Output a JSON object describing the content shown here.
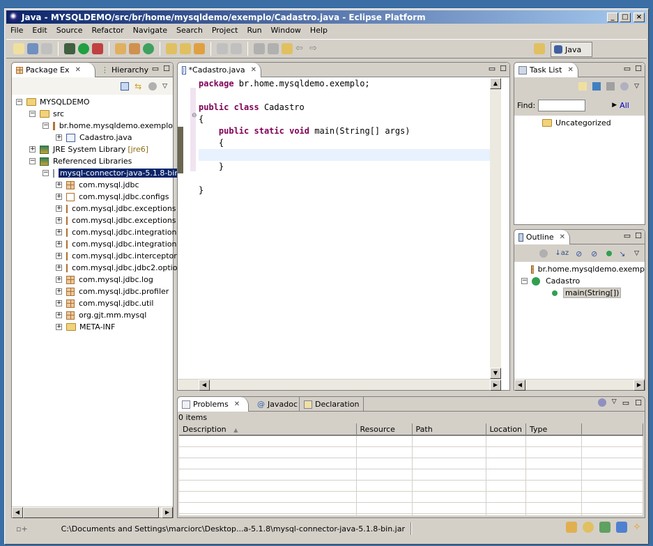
{
  "window": {
    "title": "Java - MYSQLDEMO/src/br/home/mysqldemo/exemplo/Cadastro.java - Eclipse Platform",
    "minimize": "_",
    "maximize": "□",
    "close": "×"
  },
  "menu": [
    "File",
    "Edit",
    "Source",
    "Refactor",
    "Navigate",
    "Search",
    "Project",
    "Run",
    "Window",
    "Help"
  ],
  "perspective": {
    "label": "Java"
  },
  "package_explorer": {
    "tab": "Package Ex",
    "tab2": "Hierarchy",
    "tree": [
      {
        "label": "MYSQLDEMO",
        "level": 0,
        "toggle": "−",
        "icon": "project-icon"
      },
      {
        "label": "src",
        "level": 1,
        "toggle": "−",
        "icon": "source-folder-icon"
      },
      {
        "label": "br.home.mysqldemo.exemplo",
        "level": 2,
        "toggle": "−",
        "icon": "package-icon"
      },
      {
        "label": "Cadastro.java",
        "level": 3,
        "toggle": "+",
        "icon": "java-file-icon"
      },
      {
        "label": "JRE System Library",
        "suffix": "[jre6]",
        "level": 1,
        "toggle": "+",
        "icon": "library-icon"
      },
      {
        "label": "Referenced Libraries",
        "level": 1,
        "toggle": "−",
        "icon": "library-icon"
      },
      {
        "label": "mysql-connector-java-5.1.8-bin",
        "level": 2,
        "toggle": "−",
        "icon": "jar-icon",
        "selected": true
      },
      {
        "label": "com.mysql.jdbc",
        "level": 3,
        "toggle": "+",
        "icon": "package-icon"
      },
      {
        "label": "com.mysql.jdbc.configs",
        "level": 3,
        "toggle": "+",
        "icon": "empty-package-icon"
      },
      {
        "label": "com.mysql.jdbc.exceptions",
        "level": 3,
        "toggle": "+",
        "icon": "package-icon"
      },
      {
        "label": "com.mysql.jdbc.exceptions",
        "level": 3,
        "toggle": "+",
        "icon": "package-icon"
      },
      {
        "label": "com.mysql.jdbc.integration",
        "level": 3,
        "toggle": "+",
        "icon": "package-icon"
      },
      {
        "label": "com.mysql.jdbc.integration",
        "level": 3,
        "toggle": "+",
        "icon": "package-icon"
      },
      {
        "label": "com.mysql.jdbc.interceptor",
        "level": 3,
        "toggle": "+",
        "icon": "package-icon"
      },
      {
        "label": "com.mysql.jdbc.jdbc2.optio",
        "level": 3,
        "toggle": "+",
        "icon": "package-icon"
      },
      {
        "label": "com.mysql.jdbc.log",
        "level": 3,
        "toggle": "+",
        "icon": "package-icon"
      },
      {
        "label": "com.mysql.jdbc.profiler",
        "level": 3,
        "toggle": "+",
        "icon": "package-icon"
      },
      {
        "label": "com.mysql.jdbc.util",
        "level": 3,
        "toggle": "+",
        "icon": "package-icon"
      },
      {
        "label": "org.gjt.mm.mysql",
        "level": 3,
        "toggle": "+",
        "icon": "package-icon"
      },
      {
        "label": "META-INF",
        "level": 3,
        "toggle": "+",
        "icon": "folder-icon"
      }
    ]
  },
  "editor": {
    "tab": "*Cadastro.java",
    "lines": [
      [
        {
          "t": "package",
          "k": 1
        },
        {
          "t": " br.home.mysqldemo.exemplo;"
        }
      ],
      [],
      [
        {
          "t": "public",
          "k": 1
        },
        {
          "t": " "
        },
        {
          "t": "class",
          "k": 1
        },
        {
          "t": " Cadastro"
        }
      ],
      [
        {
          "t": "{"
        }
      ],
      [
        {
          "t": "    "
        },
        {
          "t": "public",
          "k": 1
        },
        {
          "t": " "
        },
        {
          "t": "static",
          "k": 1
        },
        {
          "t": " "
        },
        {
          "t": "void",
          "k": 1
        },
        {
          "t": " main(String[] args)"
        }
      ],
      [
        {
          "t": "    {"
        }
      ],
      [],
      [
        {
          "t": "    }"
        }
      ],
      [],
      [
        {
          "t": "}"
        }
      ]
    ],
    "current_line": 7
  },
  "task_list": {
    "tab": "Task List",
    "find_label": "Find:",
    "find_value": "",
    "all_label": "All",
    "category": "Uncategorized"
  },
  "outline": {
    "tab": "Outline",
    "items": [
      {
        "label": "br.home.mysqldemo.exemp",
        "icon": "package-declaration-icon",
        "level": 0
      },
      {
        "label": "Cadastro",
        "icon": "class-icon",
        "level": 0,
        "toggle": "−"
      },
      {
        "label": "main(String[])",
        "icon": "public-static-method-icon",
        "level": 1,
        "selected": true
      }
    ]
  },
  "problems": {
    "tabs": [
      "Problems",
      "Javadoc",
      "Declaration"
    ],
    "count": "0 items",
    "columns": [
      "Description",
      "Resource",
      "Path",
      "Location",
      "Type"
    ]
  },
  "status": {
    "path": "C:\\Documents and Settings\\marciorc\\Desktop...a-5.1.8\\mysql-connector-java-5.1.8-bin.jar"
  }
}
